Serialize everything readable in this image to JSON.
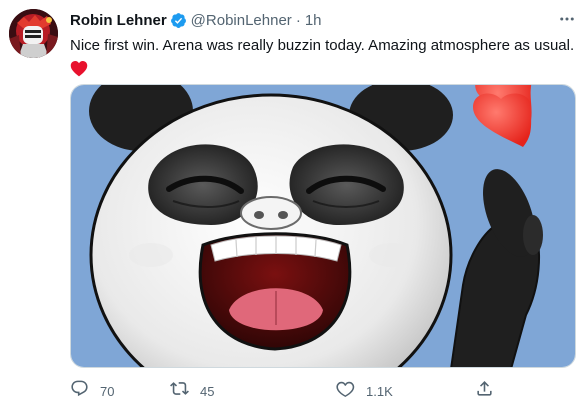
{
  "author": {
    "display_name": "Robin Lehner",
    "handle": "@RobinLehner",
    "verified": true,
    "avatar_icon": "hockey-goalie-avatar"
  },
  "meta": {
    "separator": "·",
    "time": "1h"
  },
  "more_icon": "more-dots-icon",
  "tweet": {
    "text": "Nice first win. Arena was really buzzin today. Amazing atmosphere as usual.",
    "emoji": "red-heart"
  },
  "media": {
    "description_icon": "panda-laughing-sticker",
    "background_color": "#7fa6d6"
  },
  "actions": {
    "reply": {
      "icon": "reply-icon",
      "count": "70"
    },
    "retweet": {
      "icon": "retweet-icon",
      "count": "45"
    },
    "like": {
      "icon": "heart-icon",
      "count": "1.1K"
    },
    "share": {
      "icon": "share-icon",
      "count": ""
    }
  },
  "colors": {
    "text_primary": "#0f1419",
    "text_secondary": "#536471",
    "verified_blue": "#1d9bf0",
    "heart_red": "#e8112d"
  }
}
